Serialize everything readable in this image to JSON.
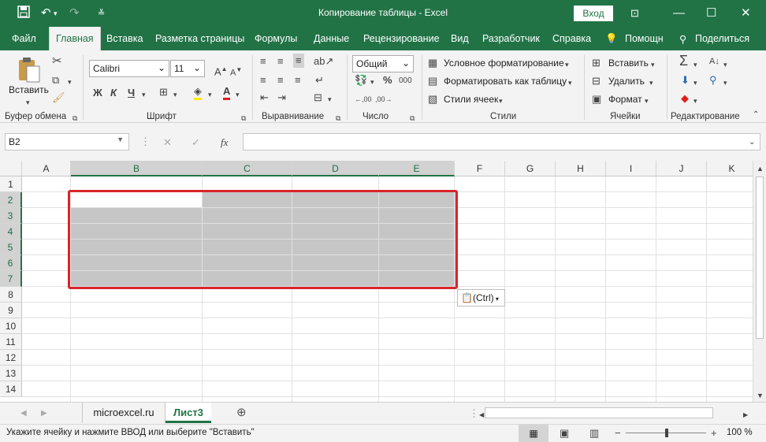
{
  "titlebar": {
    "title": "Копирование таблицы  -  Excel",
    "login_button": "Вход",
    "icons": [
      "save-icon",
      "undo-icon",
      "redo-icon",
      "customize-qat-icon",
      "ribbon-display-options-icon",
      "minimize-icon",
      "maximize-icon",
      "close-icon"
    ]
  },
  "tabs": {
    "file": "Файл",
    "home": "Главная",
    "insert": "Вставка",
    "layout": "Разметка страницы",
    "formulas": "Формулы",
    "data": "Данные",
    "review": "Рецензирование",
    "view": "Вид",
    "developer": "Разработчик",
    "help": "Справка",
    "tell_me": "Помощн",
    "share": "Поделиться"
  },
  "ribbon": {
    "clipboard": {
      "label": "Буфер обмена",
      "paste": "Вставить"
    },
    "font": {
      "label": "Шрифт",
      "name": "Calibri",
      "size": "11",
      "bold": "Ж",
      "italic": "К",
      "underline": "Ч"
    },
    "alignment": {
      "label": "Выравнивание"
    },
    "number": {
      "label": "Число",
      "format": "Общий",
      "percent": "%",
      "comma": "000"
    },
    "styles": {
      "label": "Стили",
      "conditional": "Условное форматирование",
      "as_table": "Форматировать как таблицу",
      "cell_styles": "Стили ячеек"
    },
    "cells": {
      "label": "Ячейки",
      "insert": "Вставить",
      "delete": "Удалить",
      "format": "Формат"
    },
    "editing": {
      "label": "Редактирование"
    }
  },
  "formula_bar": {
    "name_box": "B2",
    "fx": "fx",
    "value": ""
  },
  "sheet": {
    "columns": [
      "A",
      "B",
      "C",
      "D",
      "E",
      "F",
      "G",
      "H",
      "I",
      "J",
      "K"
    ],
    "rows": [
      "1",
      "2",
      "3",
      "4",
      "5",
      "6",
      "7",
      "8",
      "9",
      "10",
      "11",
      "12",
      "13",
      "14"
    ],
    "selected_columns": [
      "B",
      "C",
      "D",
      "E"
    ],
    "selected_rows": [
      "2",
      "3",
      "4",
      "5",
      "6",
      "7"
    ],
    "paste_options": "(Ctrl)"
  },
  "sheet_tabs": [
    "microexcel.ru",
    "Лист3"
  ],
  "active_sheet": "Лист3",
  "status": {
    "message": "Укажите ячейку и нажмите ВВОД или выберите \"Вставить\"",
    "zoom": "100 %"
  },
  "colors": {
    "accent": "#217346",
    "highlight_border": "#d8262b",
    "selection_fill": "#c6c6c6"
  }
}
